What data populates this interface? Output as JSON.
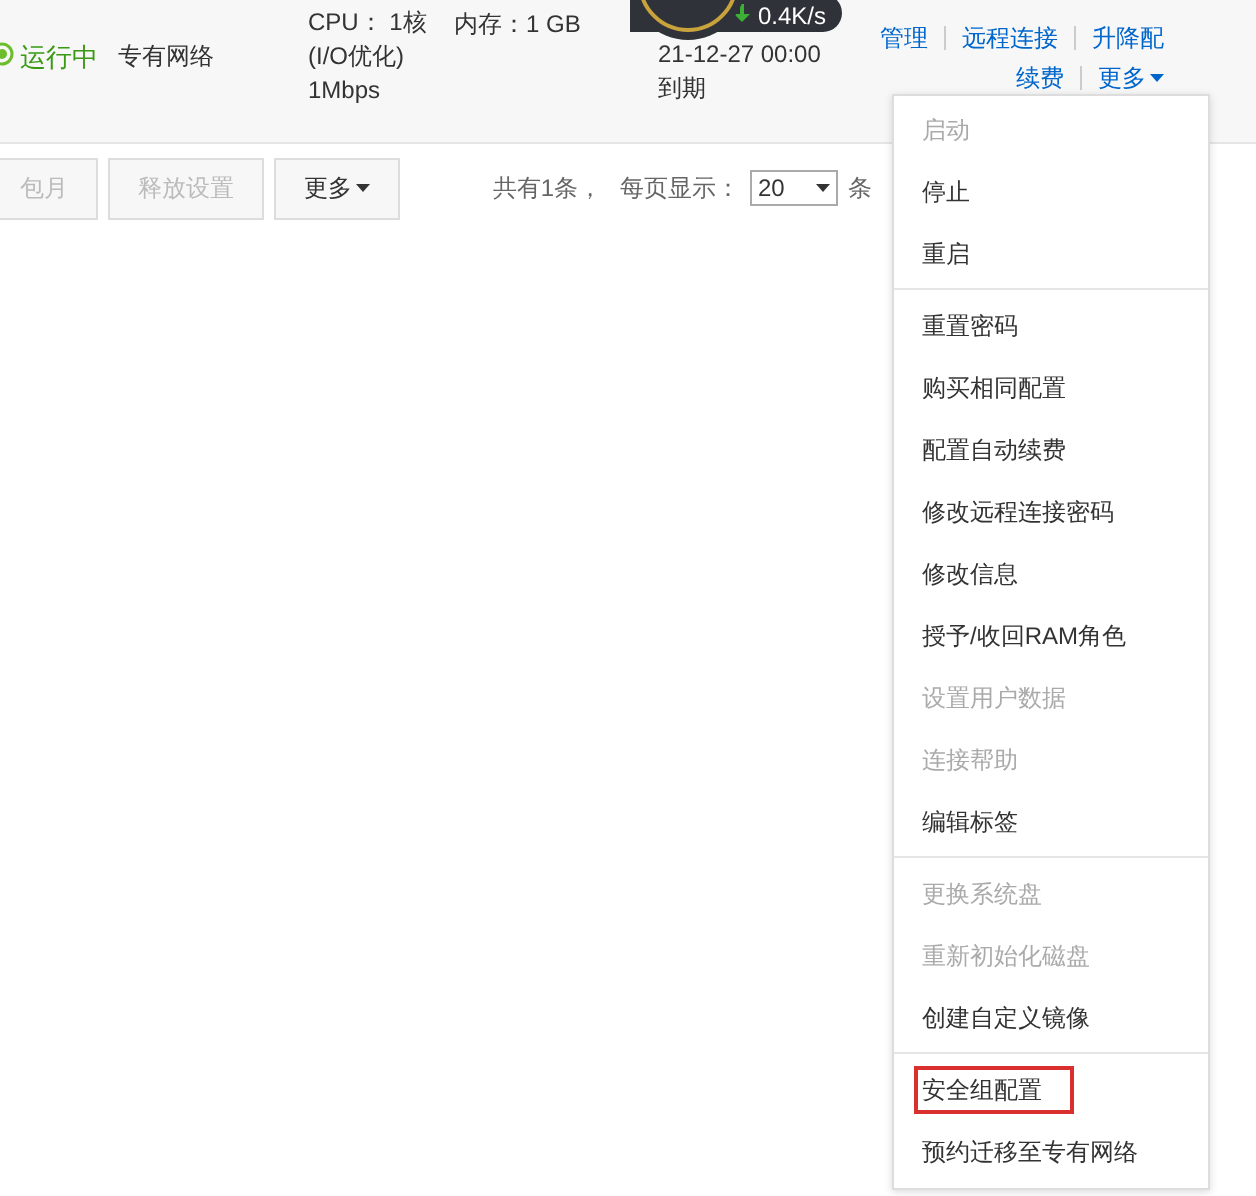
{
  "instance": {
    "status": "运行中",
    "network": "专有网络",
    "cpu": "CPU： 1核",
    "cpu_note": "(I/O优化)",
    "bandwidth": "1Mbps",
    "memory": "内存：1 GB",
    "traffic": "0.4K/s",
    "expiry_date": "21-12-27 00:00",
    "expiry_label": "到期",
    "actions": [
      {
        "label": "管理",
        "dropdown": false
      },
      {
        "label": "远程连接",
        "dropdown": false
      },
      {
        "label": "升降配",
        "dropdown": false
      }
    ],
    "actions_row_2": [
      {
        "label": "续费",
        "dropdown": false
      },
      {
        "label": "更多",
        "dropdown": true
      }
    ]
  },
  "toolbar": {
    "buttons": [
      {
        "label": "包月",
        "disabled": true,
        "dropdown": false
      },
      {
        "label": "释放设置",
        "disabled": true,
        "dropdown": false
      },
      {
        "label": "更多",
        "disabled": false,
        "dropdown": true
      }
    ],
    "total": "共有1条，",
    "page_size_label": "每页显示：",
    "page_size": "20",
    "page_size_unit": "条"
  },
  "menu": {
    "groups": [
      [
        {
          "label": "启动",
          "disabled": true,
          "highlighted": false
        },
        {
          "label": "停止",
          "disabled": false,
          "highlighted": false
        },
        {
          "label": "重启",
          "disabled": false,
          "highlighted": false
        }
      ],
      [
        {
          "label": "重置密码",
          "disabled": false,
          "highlighted": false
        },
        {
          "label": "购买相同配置",
          "disabled": false,
          "highlighted": false
        },
        {
          "label": "配置自动续费",
          "disabled": false,
          "highlighted": false
        },
        {
          "label": "修改远程连接密码",
          "disabled": false,
          "highlighted": false
        },
        {
          "label": "修改信息",
          "disabled": false,
          "highlighted": false
        },
        {
          "label": "授予/收回RAM角色",
          "disabled": false,
          "highlighted": false
        },
        {
          "label": "设置用户数据",
          "disabled": true,
          "highlighted": false
        },
        {
          "label": "连接帮助",
          "disabled": true,
          "highlighted": false
        },
        {
          "label": "编辑标签",
          "disabled": false,
          "highlighted": false
        }
      ],
      [
        {
          "label": "更换系统盘",
          "disabled": true,
          "highlighted": false
        },
        {
          "label": "重新初始化磁盘",
          "disabled": true,
          "highlighted": false
        },
        {
          "label": "创建自定义镜像",
          "disabled": false,
          "highlighted": false
        }
      ],
      [
        {
          "label": "安全组配置",
          "disabled": false,
          "highlighted": true
        },
        {
          "label": "预约迁移至专有网络",
          "disabled": false,
          "highlighted": false
        }
      ]
    ]
  }
}
